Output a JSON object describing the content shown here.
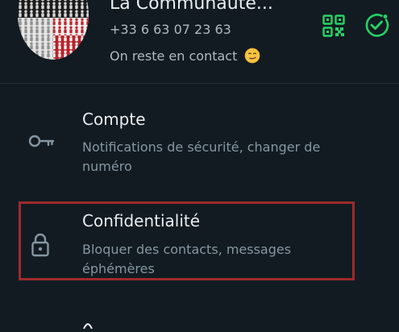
{
  "profile": {
    "name": "La Communauté...",
    "phone": "+33 6 63 07 23 63",
    "status": "On reste en contact",
    "status_emoji": "smirking-face",
    "avatar": "community-group-avatar"
  },
  "header_actions": {
    "qr_icon": "qr-code-icon",
    "check_icon": "check-circle-icon",
    "accent_color": "#25d366"
  },
  "settings": {
    "items": [
      {
        "title": "Compte",
        "subtitle": "Notifications de sécurité, changer de numéro",
        "icon": "key-icon"
      },
      {
        "title": "Confidentialité",
        "subtitle": "Bloquer des contacts, messages éphémères",
        "icon": "lock-icon"
      }
    ]
  },
  "highlight": {
    "color": "#9e2a2b",
    "target": "Confidentialité"
  },
  "theme": {
    "background": "#121b22",
    "text_primary": "#e9edef",
    "text_secondary": "#8696a0"
  }
}
